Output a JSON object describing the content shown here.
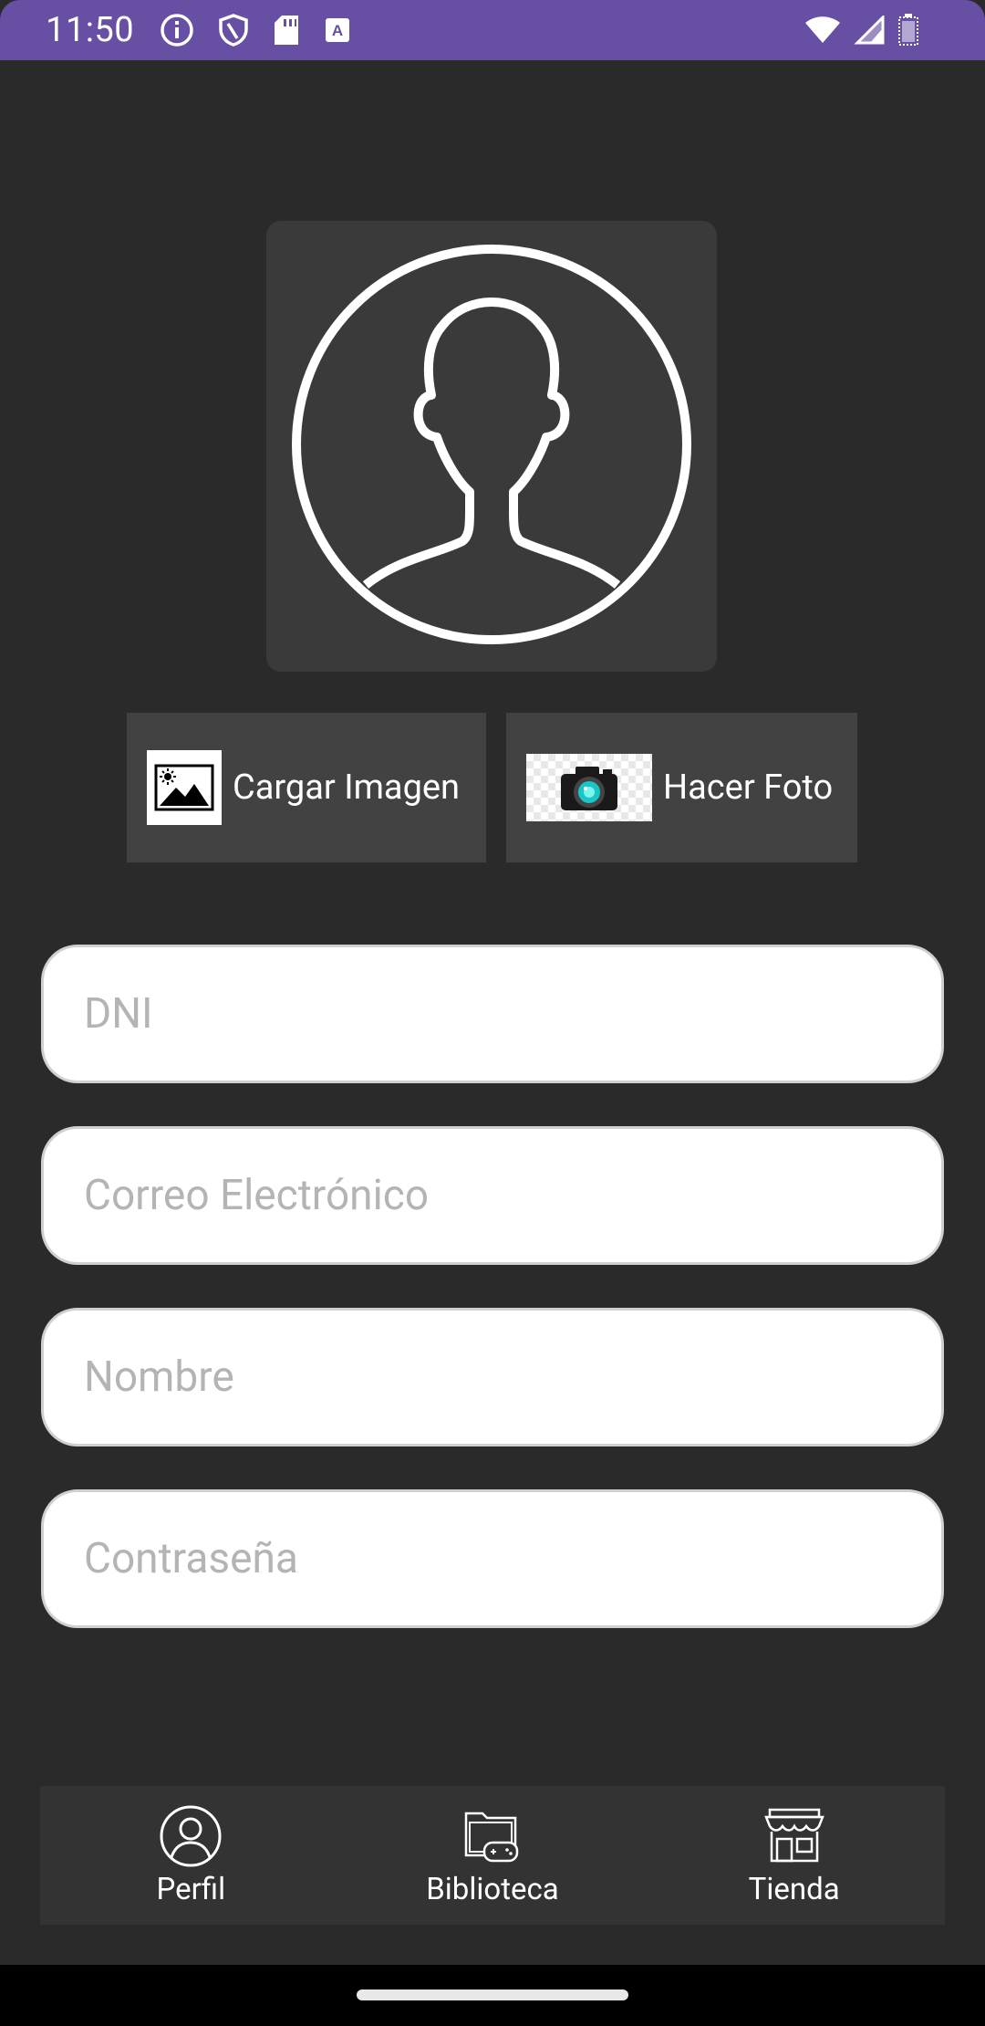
{
  "status_bar": {
    "time": "11:50",
    "color": "#6750a4",
    "left_icons": [
      "info-icon",
      "shield-icon",
      "sd-card-icon",
      "keyboard-a-icon"
    ],
    "right_icons": [
      "wifi-icon",
      "signal-icon",
      "battery-icon"
    ]
  },
  "profile": {
    "avatar_icon": "person-circle-icon"
  },
  "media_buttons": {
    "load_image_label": "Cargar Imagen",
    "take_photo_label": "Hacer Foto"
  },
  "form": {
    "dni_placeholder": "DNI",
    "dni_value": "",
    "email_placeholder": "Correo Electrónico",
    "email_value": "",
    "name_placeholder": "Nombre",
    "name_value": "",
    "password_placeholder": "Contraseña",
    "password_value": ""
  },
  "bottom_nav": {
    "items": [
      {
        "label": "Perfil",
        "icon": "person-icon"
      },
      {
        "label": "Biblioteca",
        "icon": "folder-gamepad-icon"
      },
      {
        "label": "Tienda",
        "icon": "store-icon"
      }
    ]
  }
}
